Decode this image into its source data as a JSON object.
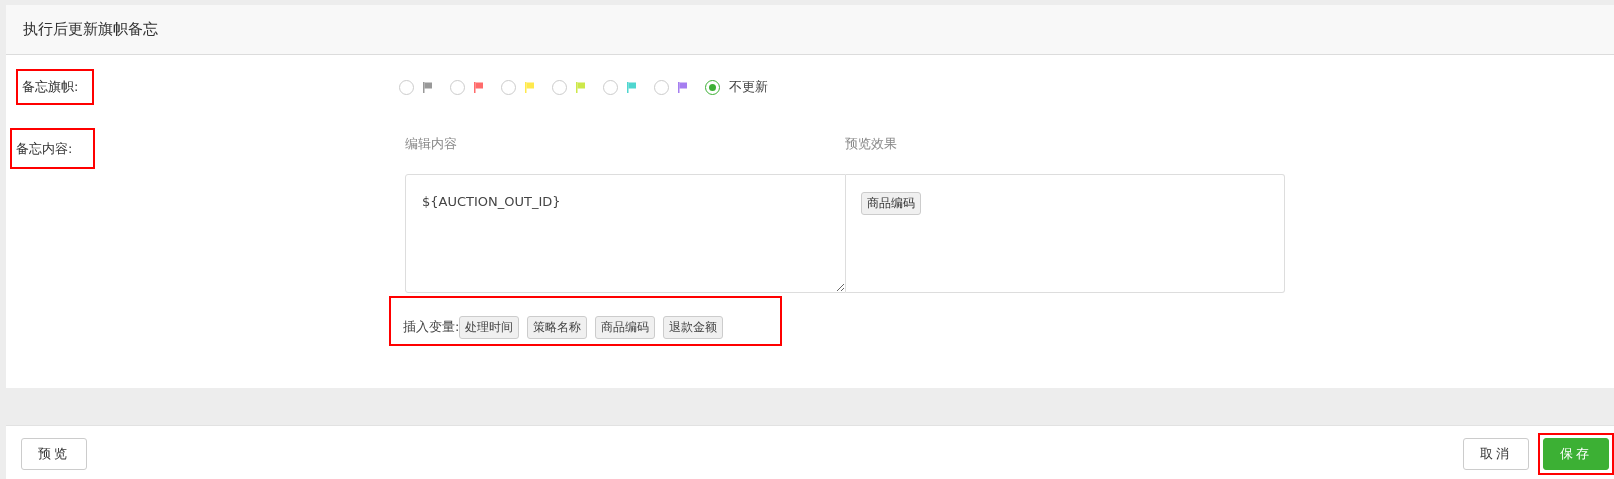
{
  "panel": {
    "title": "执行后更新旗帜备忘"
  },
  "flag_field": {
    "label": "备忘旗帜:",
    "annotated": true,
    "options": [
      {
        "kind": "flag",
        "color": "#999999",
        "selected": false
      },
      {
        "kind": "flag",
        "color": "#ff6b6b",
        "selected": false
      },
      {
        "kind": "flag",
        "color": "#ffe94d",
        "selected": false
      },
      {
        "kind": "flag",
        "color": "#cde84a",
        "selected": false
      },
      {
        "kind": "flag",
        "color": "#4fd6cf",
        "selected": false
      },
      {
        "kind": "flag",
        "color": "#a57ef0",
        "selected": false
      },
      {
        "kind": "text",
        "label": "不更新",
        "selected": true
      }
    ]
  },
  "content_field": {
    "label": "备忘内容:",
    "annotated": true,
    "editor": {
      "heading": "编辑内容",
      "value": "${AUCTION_OUT_ID}"
    },
    "preview": {
      "heading": "预览效果",
      "tags": [
        "商品编码"
      ]
    },
    "insert_variables": {
      "label": "插入变量:",
      "annotated": true,
      "variables": [
        "处理时间",
        "策略名称",
        "商品编码",
        "退款金额"
      ]
    }
  },
  "footer": {
    "buttons": [
      {
        "label": "预览",
        "kind": "plain",
        "annotated": false
      },
      {
        "label": "取消",
        "kind": "plain",
        "annotated": false
      },
      {
        "label": "保存",
        "kind": "primary",
        "annotated": true
      }
    ]
  }
}
